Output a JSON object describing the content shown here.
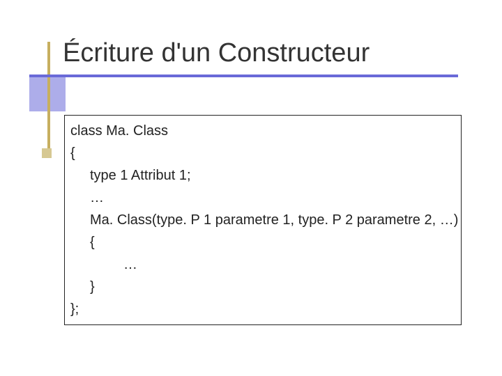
{
  "title": "Écriture d'un Constructeur",
  "code": {
    "l1": "class Ma. Class",
    "l2": "{",
    "l3": "type 1 Attribut 1;",
    "l4": "…",
    "l5": "Ma. Class(type. P 1 parametre 1, type. P 2 parametre 2, …)",
    "l6": "{",
    "l7": "…",
    "l8": "}",
    "l9": "};"
  }
}
